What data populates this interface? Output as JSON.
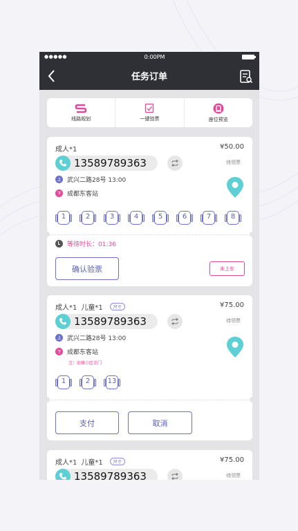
{
  "status_bar": {
    "signal": "●●●●●",
    "time": "0:00PM"
  },
  "nav": {
    "title": "任务订单"
  },
  "tools": [
    {
      "label": "线路规划",
      "icon": "route-s-icon"
    },
    {
      "label": "一键验票",
      "icon": "check-ticket-icon"
    },
    {
      "label": "座位预览",
      "icon": "seat-preview-icon"
    }
  ],
  "orders": [
    {
      "passengers": "成人*1",
      "price": "¥50.00",
      "phone": "13589789363",
      "status": "待领票",
      "start": "武兴二路28号  13:00",
      "start_tag": "上",
      "end": "成都东客站",
      "end_tag": "下",
      "seats": [
        "1",
        "2",
        "3",
        "4",
        "5",
        "6",
        "7",
        "8"
      ],
      "wait": "等待时长：01:36",
      "confirm": "确认验票",
      "not_boarded": "未上车"
    },
    {
      "adult": "成人*1",
      "child": "儿童*1",
      "child_tag": "尺寸",
      "price": "¥75.00",
      "phone": "13589789363",
      "status": "待领票",
      "start": "武兴二路28号  13:00",
      "start_tag": "上",
      "end": "成都东客站",
      "end_tag": "下",
      "note": "注：宏峰小区正门",
      "seats": [
        "1",
        "2",
        "13"
      ],
      "pay": "支付",
      "cancel": "取消"
    },
    {
      "adult": "成人*1",
      "child": "儿童*1",
      "child_tag": "尺寸",
      "price": "¥75.00",
      "phone": "13589789363",
      "status": "待领票"
    }
  ],
  "colors": {
    "accent": "#6b70c8",
    "pink": "#e04a9a",
    "teal": "#5ecfd3",
    "bar": "#2e3035"
  }
}
